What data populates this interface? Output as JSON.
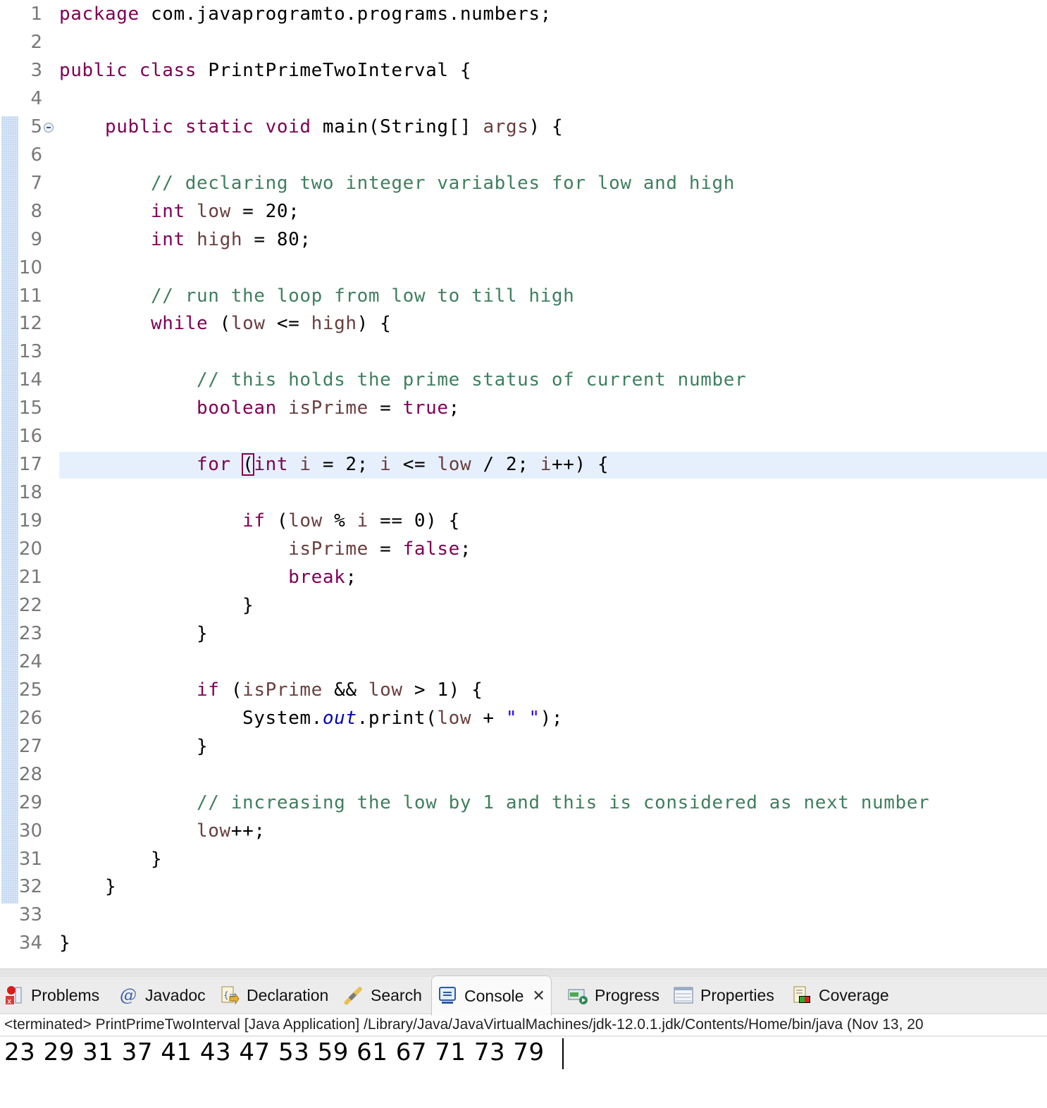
{
  "editor": {
    "current_line": 17,
    "fold_line": 5,
    "lines": [
      {
        "n": "1",
        "tokens": [
          [
            "kw",
            "package"
          ],
          [
            "plain",
            " com.javaprogramto.programs.numbers;"
          ]
        ]
      },
      {
        "n": "2",
        "tokens": []
      },
      {
        "n": "3",
        "tokens": [
          [
            "kw",
            "public"
          ],
          [
            "plain",
            " "
          ],
          [
            "kw",
            "class"
          ],
          [
            "plain",
            " PrintPrimeTwoInterval {"
          ]
        ]
      },
      {
        "n": "4",
        "tokens": []
      },
      {
        "n": "5",
        "tokens": [
          [
            "plain",
            "    "
          ],
          [
            "kw",
            "public"
          ],
          [
            "plain",
            " "
          ],
          [
            "kw",
            "static"
          ],
          [
            "plain",
            " "
          ],
          [
            "kw",
            "void"
          ],
          [
            "plain",
            " main(String[] "
          ],
          [
            "var",
            "args"
          ],
          [
            "plain",
            ") {"
          ]
        ]
      },
      {
        "n": "6",
        "tokens": []
      },
      {
        "n": "7",
        "tokens": [
          [
            "plain",
            "        "
          ],
          [
            "cm",
            "// declaring two integer variables for low and high"
          ]
        ]
      },
      {
        "n": "8",
        "tokens": [
          [
            "plain",
            "        "
          ],
          [
            "kw",
            "int"
          ],
          [
            "plain",
            " "
          ],
          [
            "var",
            "low"
          ],
          [
            "plain",
            " = 20;"
          ]
        ]
      },
      {
        "n": "9",
        "tokens": [
          [
            "plain",
            "        "
          ],
          [
            "kw",
            "int"
          ],
          [
            "plain",
            " "
          ],
          [
            "var",
            "high"
          ],
          [
            "plain",
            " = 80;"
          ]
        ]
      },
      {
        "n": "10",
        "tokens": []
      },
      {
        "n": "11",
        "tokens": [
          [
            "plain",
            "        "
          ],
          [
            "cm",
            "// run the loop from low to till high"
          ]
        ]
      },
      {
        "n": "12",
        "tokens": [
          [
            "plain",
            "        "
          ],
          [
            "kw",
            "while"
          ],
          [
            "plain",
            " ("
          ],
          [
            "var",
            "low"
          ],
          [
            "plain",
            " <= "
          ],
          [
            "var",
            "high"
          ],
          [
            "plain",
            ") {"
          ]
        ]
      },
      {
        "n": "13",
        "tokens": []
      },
      {
        "n": "14",
        "tokens": [
          [
            "plain",
            "            "
          ],
          [
            "cm",
            "// this holds the prime status of current number"
          ]
        ]
      },
      {
        "n": "15",
        "tokens": [
          [
            "plain",
            "            "
          ],
          [
            "kw",
            "boolean"
          ],
          [
            "plain",
            " "
          ],
          [
            "var",
            "isPrime"
          ],
          [
            "plain",
            " = "
          ],
          [
            "kw",
            "true"
          ],
          [
            "plain",
            ";"
          ]
        ]
      },
      {
        "n": "16",
        "tokens": []
      },
      {
        "n": "17",
        "tokens": [
          [
            "plain",
            "            "
          ],
          [
            "kw",
            "for"
          ],
          [
            "plain",
            " "
          ],
          [
            "bracket",
            "("
          ],
          [
            "kw",
            "int"
          ],
          [
            "plain",
            " "
          ],
          [
            "var",
            "i"
          ],
          [
            "plain",
            " = 2; "
          ],
          [
            "var",
            "i"
          ],
          [
            "plain",
            " <= "
          ],
          [
            "var",
            "low"
          ],
          [
            "plain",
            " / 2; "
          ],
          [
            "var",
            "i"
          ],
          [
            "plain",
            "++) {"
          ]
        ]
      },
      {
        "n": "18",
        "tokens": []
      },
      {
        "n": "19",
        "tokens": [
          [
            "plain",
            "                "
          ],
          [
            "kw",
            "if"
          ],
          [
            "plain",
            " ("
          ],
          [
            "var",
            "low"
          ],
          [
            "plain",
            " % "
          ],
          [
            "var",
            "i"
          ],
          [
            "plain",
            " == 0) {"
          ]
        ]
      },
      {
        "n": "20",
        "tokens": [
          [
            "plain",
            "                    "
          ],
          [
            "var",
            "isPrime"
          ],
          [
            "plain",
            " = "
          ],
          [
            "kw",
            "false"
          ],
          [
            "plain",
            ";"
          ]
        ]
      },
      {
        "n": "21",
        "tokens": [
          [
            "plain",
            "                    "
          ],
          [
            "kw",
            "break"
          ],
          [
            "plain",
            ";"
          ]
        ]
      },
      {
        "n": "22",
        "tokens": [
          [
            "plain",
            "                }"
          ]
        ]
      },
      {
        "n": "23",
        "tokens": [
          [
            "plain",
            "            }"
          ]
        ]
      },
      {
        "n": "24",
        "tokens": []
      },
      {
        "n": "25",
        "tokens": [
          [
            "plain",
            "            "
          ],
          [
            "kw",
            "if"
          ],
          [
            "plain",
            " ("
          ],
          [
            "var",
            "isPrime"
          ],
          [
            "plain",
            " && "
          ],
          [
            "var",
            "low"
          ],
          [
            "plain",
            " > 1) {"
          ]
        ]
      },
      {
        "n": "26",
        "tokens": [
          [
            "plain",
            "                System."
          ],
          [
            "fld",
            "out"
          ],
          [
            "plain",
            ".print("
          ],
          [
            "var",
            "low"
          ],
          [
            "plain",
            " + "
          ],
          [
            "str",
            "\" \""
          ],
          [
            "plain",
            ");"
          ]
        ]
      },
      {
        "n": "27",
        "tokens": [
          [
            "plain",
            "            }"
          ]
        ]
      },
      {
        "n": "28",
        "tokens": []
      },
      {
        "n": "29",
        "tokens": [
          [
            "plain",
            "            "
          ],
          [
            "cm",
            "// increasing the low by 1 and this is considered as next number"
          ]
        ]
      },
      {
        "n": "30",
        "tokens": [
          [
            "plain",
            "            "
          ],
          [
            "var",
            "low"
          ],
          [
            "plain",
            "++;"
          ]
        ]
      },
      {
        "n": "31",
        "tokens": [
          [
            "plain",
            "        }"
          ]
        ]
      },
      {
        "n": "32",
        "tokens": [
          [
            "plain",
            "    }"
          ]
        ]
      },
      {
        "n": "33",
        "tokens": []
      },
      {
        "n": "34",
        "tokens": [
          [
            "plain",
            "}"
          ]
        ]
      }
    ]
  },
  "bottom_panel": {
    "tabs": [
      {
        "label": "Problems",
        "icon": "problems-icon",
        "active": false
      },
      {
        "label": "Javadoc",
        "icon": "javadoc-icon",
        "active": false
      },
      {
        "label": "Declaration",
        "icon": "declaration-icon",
        "active": false
      },
      {
        "label": "Search",
        "icon": "search-icon",
        "active": false
      },
      {
        "label": "Console",
        "icon": "console-icon",
        "active": true
      },
      {
        "label": "Progress",
        "icon": "progress-icon",
        "active": false
      },
      {
        "label": "Properties",
        "icon": "properties-icon",
        "active": false
      },
      {
        "label": "Coverage",
        "icon": "coverage-icon",
        "active": false
      }
    ],
    "close_glyph": "✕",
    "console_header": "<terminated> PrintPrimeTwoInterval [Java Application] /Library/Java/JavaVirtualMachines/jdk-12.0.1.jdk/Contents/Home/bin/java  (Nov 13, 20",
    "console_output": "23 29 31 37 41 43 47 53 59 61 67 71 73 79 "
  },
  "colors": {
    "keyword": "#7f0055",
    "comment": "#3f7f5f",
    "variable": "#6a3e3e",
    "field": "#0000c0",
    "string": "#2a00ff",
    "current_line": "#e6f0fc"
  }
}
